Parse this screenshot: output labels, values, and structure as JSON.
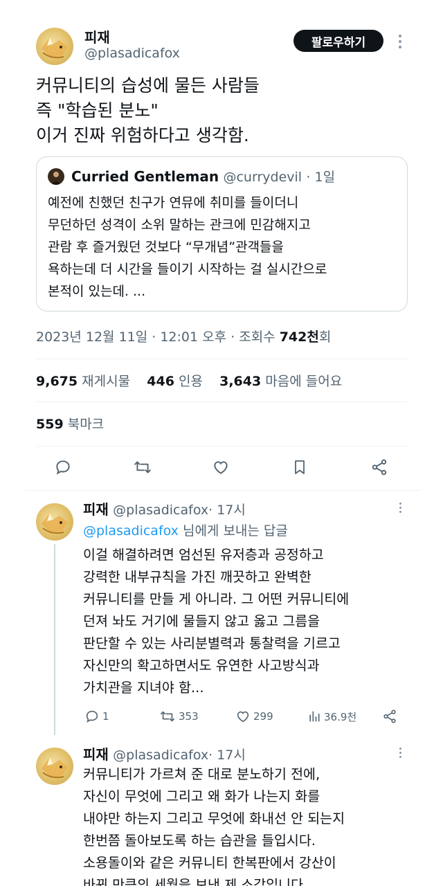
{
  "main_tweet": {
    "display_name": "피재",
    "handle": "@plasadicafox",
    "follow_label": "팔로우하기",
    "text_lines": [
      "커뮤니티의 습성에 물든 사람들",
      "즉 \"학습된 분노\"",
      "이거 진짜 위험하다고 생각함."
    ],
    "quote": {
      "name": "Curried Gentleman",
      "handle": "@currydevil",
      "time": "· 1일",
      "text_lines": [
        "예전에 친했던 친구가 연뮤에 취미를 들이더니",
        "무던하던 성격이 소위 말하는 관크에 민감해지고",
        "관람 후 즐거웠던 것보다 “무개념”관객들을",
        "욕하는데 더 시간을 들이기 시작하는 걸 실시간으로",
        "본적이 있는데. ..."
      ]
    },
    "meta": {
      "datetime": "2023년 12월 11일 · 12:01 오후 · 조회수 ",
      "views": "742천",
      "views_suffix": "회"
    },
    "stats": {
      "retweets": "9,675",
      "retweets_label": "재게시물",
      "quotes": "446",
      "quotes_label": "인용",
      "likes": "3,643",
      "likes_label": "마음에 들어요",
      "bookmarks": "559",
      "bookmarks_label": "북마크"
    }
  },
  "replies": [
    {
      "display_name": "피재",
      "handle": "@plasadicafox",
      "time": "· 17시",
      "reply_to": "@plasadicafox",
      "reply_to_suffix": " 님에게 보내는 답글",
      "text_lines": [
        "이걸 해결하려면 엄선된 유저층과 공정하고",
        "강력한 내부규칙을 가진 깨끗하고 완벽한",
        "커뮤니티를 만들 게 아니라. 그 어떤 커뮤니티에",
        "던져 놔도 거기에 물들지 않고 옳고 그름을",
        "판단할 수 있는 사리분별력과 통찰력을 기르고",
        "자신만의 확고하면서도 유연한 사고방식과",
        "가치관을 지녀야 함..."
      ],
      "metrics": {
        "replies": "1",
        "retweets": "353",
        "likes": "299",
        "views": "36.9천"
      }
    },
    {
      "display_name": "피재",
      "handle": "@plasadicafox",
      "time": "· 17시",
      "text_lines": [
        "커뮤니티가 가르쳐 준 대로 분노하기 전에,",
        "자신이 무엇에 그리고 왜 화가 나는지 화를",
        "내야만 하는지 그리고 무엇에 화내선 안 되는지",
        "한번쯤 돌아보도록 하는 습관을 들입시다.",
        "소용돌이와 같은 커뮤니티 한복판에서 강산이",
        "바뀌 만큼의 세월을 보낸 제 소감입니다"
      ]
    }
  ],
  "colors": {
    "accent": "#1d9bf0",
    "text": "#0f1419",
    "muted": "#536471",
    "border": "#cfd9de"
  }
}
